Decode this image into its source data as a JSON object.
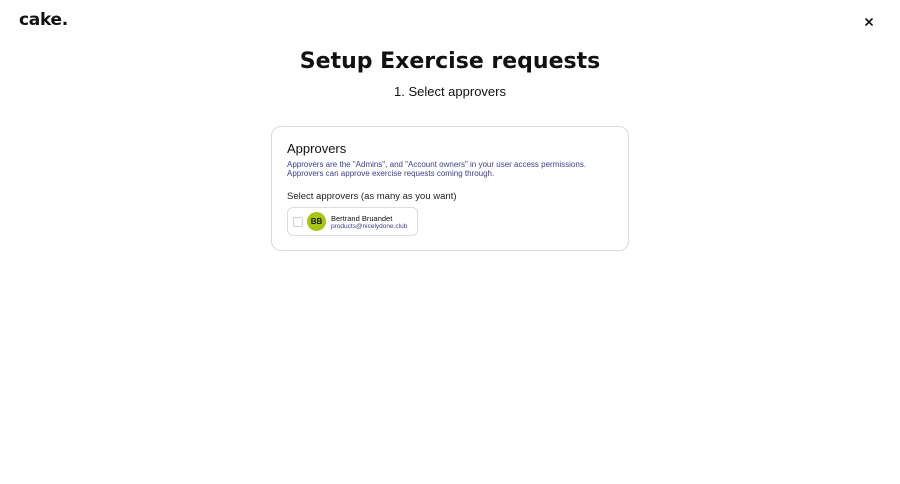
{
  "brand": {
    "logo_text": "cake."
  },
  "header": {
    "close_icon": "close-icon"
  },
  "main": {
    "title": "Setup Exercise requests",
    "step_label": "1. Select approvers"
  },
  "approvers_card": {
    "title": "Approvers",
    "description": "Approvers are the \"Admins\", and \"Account owners\" in your user access permissions. Approvers can approve exercise requests coming through.",
    "select_label": "Select approvers (as many as you want)",
    "approvers": [
      {
        "initials": "BB",
        "name": "Bertrand Bruandet",
        "email": "products@nicelydone.club",
        "selected": false,
        "avatar_color": "#a8c41a"
      }
    ]
  }
}
